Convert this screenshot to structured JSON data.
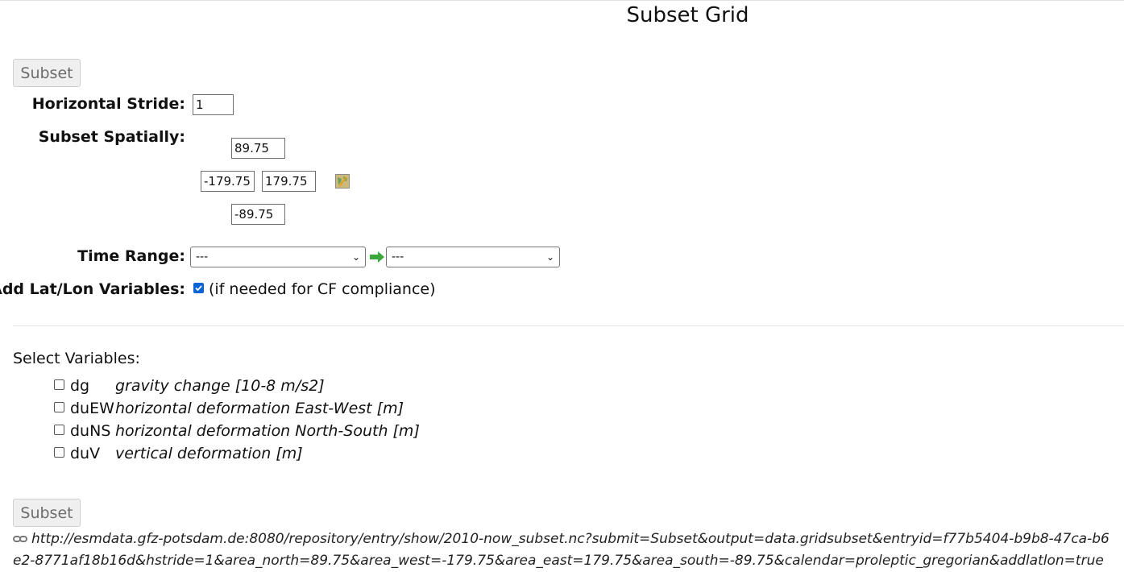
{
  "page": {
    "title": "Subset Grid"
  },
  "buttons": {
    "subset_top": "Subset",
    "subset_bottom": "Subset"
  },
  "form": {
    "horizontal_stride_label": "Horizontal Stride:",
    "horizontal_stride_value": "1",
    "subset_spatially_label": "Subset Spatially:",
    "north": "89.75",
    "west": "-179.75",
    "east": "179.75",
    "south": "-89.75",
    "map_icon": "map-icon",
    "time_range_label": "Time Range:",
    "time_start": "---",
    "time_end": "---",
    "time_arrow_icon": "arrow-right-icon",
    "add_latlon_label": "Add Lat/Lon Variables:",
    "add_latlon_checked": true,
    "add_latlon_note": "(if needed for CF compliance)"
  },
  "variables": {
    "heading": "Select Variables:",
    "items": [
      {
        "name": "dg",
        "description": "gravity change [10-8 m/s2]",
        "checked": false
      },
      {
        "name": "duEW",
        "description": "horizontal deformation East-West [m]",
        "checked": false
      },
      {
        "name": "duNS",
        "description": "horizontal deformation North-South [m]",
        "checked": false
      },
      {
        "name": "duV",
        "description": "vertical deformation [m]",
        "checked": false
      }
    ]
  },
  "footer": {
    "link_icon": "link-icon",
    "url": "http://esmdata.gfz-potsdam.de:8080/repository/entry/show/2010-now_subset.nc?submit=Subset&output=data.gridsubset&entryid=f77b5404-b9b8-47ca-b6e2-8771af18b16d&hstride=1&area_north=89.75&area_west=-179.75&area_east=179.75&area_south=-89.75&calendar=proleptic_gregorian&addlatlon=true"
  },
  "colors": {
    "checkbox_checked": "#0a64d8",
    "arrow_green": "#3aa83a",
    "button_bg": "#efefef"
  }
}
